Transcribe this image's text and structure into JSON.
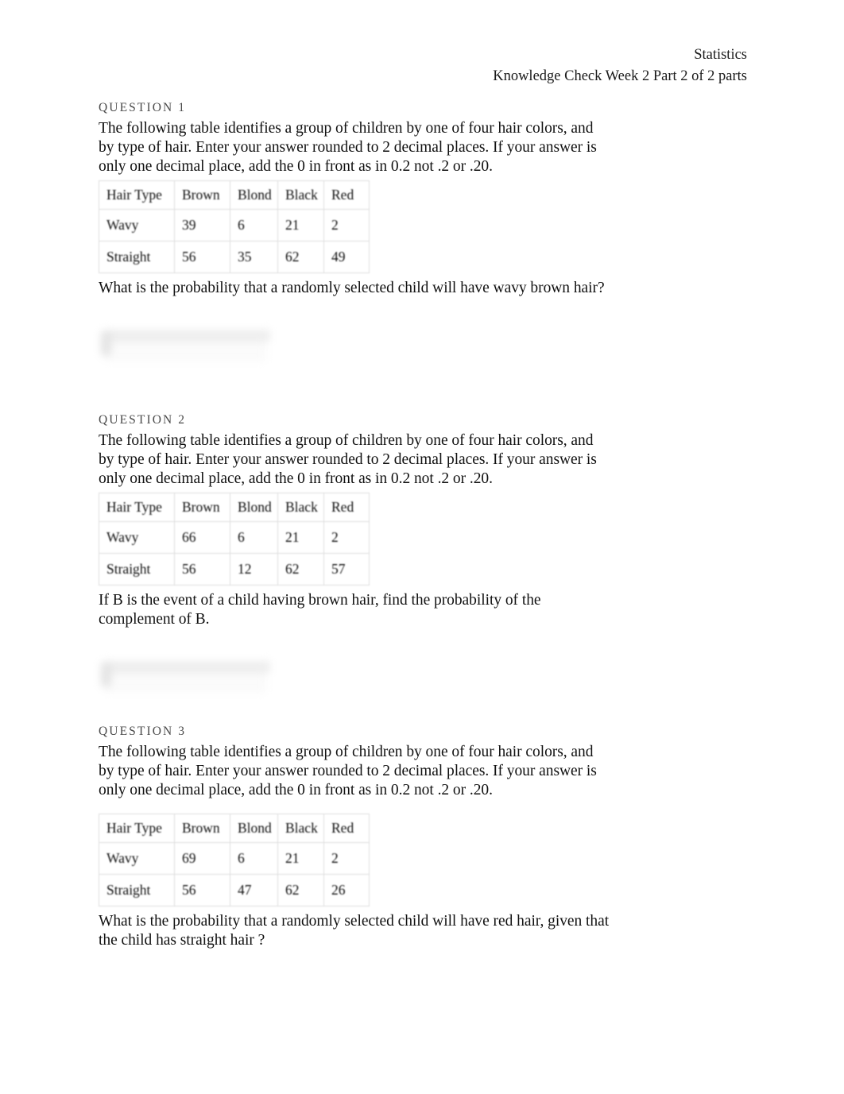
{
  "header": {
    "course": "Statistics",
    "assignment": "Knowledge Check Week 2 Part 2 of 2 parts"
  },
  "table_headers": [
    "Hair Type",
    "Brown",
    "Blond",
    "Black",
    "Red"
  ],
  "shared": {
    "intro": "The following table identifies a group of children by one of four hair colors, and by type of hair. Enter your answer rounded to 2 decimal places. If your answer is only one decimal place, add the 0 in front as in 0.2 not .2 or .20."
  },
  "questions": [
    {
      "label": "QUESTION 1",
      "intro": "The following table identifies a group of children by one of four hair colors, and by type of hair. Enter your answer rounded to 2 decimal places. If your answer is only one decimal place, add the 0 in front as in 0.2 not .2 or .20.",
      "table": {
        "headers": [
          "Hair Type",
          "Brown",
          "Blond",
          "Black",
          "Red"
        ],
        "rows": [
          {
            "type": "Wavy",
            "brown": "39",
            "blond": "6",
            "black": "21",
            "red": "2"
          },
          {
            "type": "Straight",
            "brown": "56",
            "blond": "35",
            "black": "62",
            "red": "49"
          }
        ]
      },
      "prompt": "What is the probability that a randomly selected child will have wavy brown hair?",
      "answer_value": ""
    },
    {
      "label": "QUESTION 2",
      "intro": "The following table identifies a group of children by one of four hair colors, and by type of hair. Enter your answer rounded to 2 decimal places. If your answer is only one decimal place, add the 0 in front as in 0.2 not .2 or .20.",
      "table": {
        "headers": [
          "Hair Type",
          "Brown",
          "Blond",
          "Black",
          "Red"
        ],
        "rows": [
          {
            "type": "Wavy",
            "brown": "66",
            "blond": "6",
            "black": "21",
            "red": "2"
          },
          {
            "type": "Straight",
            "brown": "56",
            "blond": "12",
            "black": "62",
            "red": "57"
          }
        ]
      },
      "prompt": "If B is the event of a child having brown hair, find the probability of the complement of B.",
      "answer_value": ""
    },
    {
      "label": "QUESTION 3",
      "intro": "The following table identifies a group of children by one of four hair colors, and by type of hair. Enter your answer rounded to 2 decimal places. If your answer is only one decimal place, add the 0 in front as in 0.2 not .2 or .20.",
      "table": {
        "headers": [
          "Hair Type",
          "Brown",
          "Blond",
          "Black",
          "Red"
        ],
        "rows": [
          {
            "type": "Wavy",
            "brown": "69",
            "blond": "6",
            "black": "21",
            "red": "2"
          },
          {
            "type": "Straight",
            "brown": "56",
            "blond": "47",
            "black": "62",
            "red": "26"
          }
        ]
      },
      "prompt": "What is the probability that a randomly selected child will have red hair, given that the child has straight hair                ?",
      "answer_value": ""
    }
  ]
}
